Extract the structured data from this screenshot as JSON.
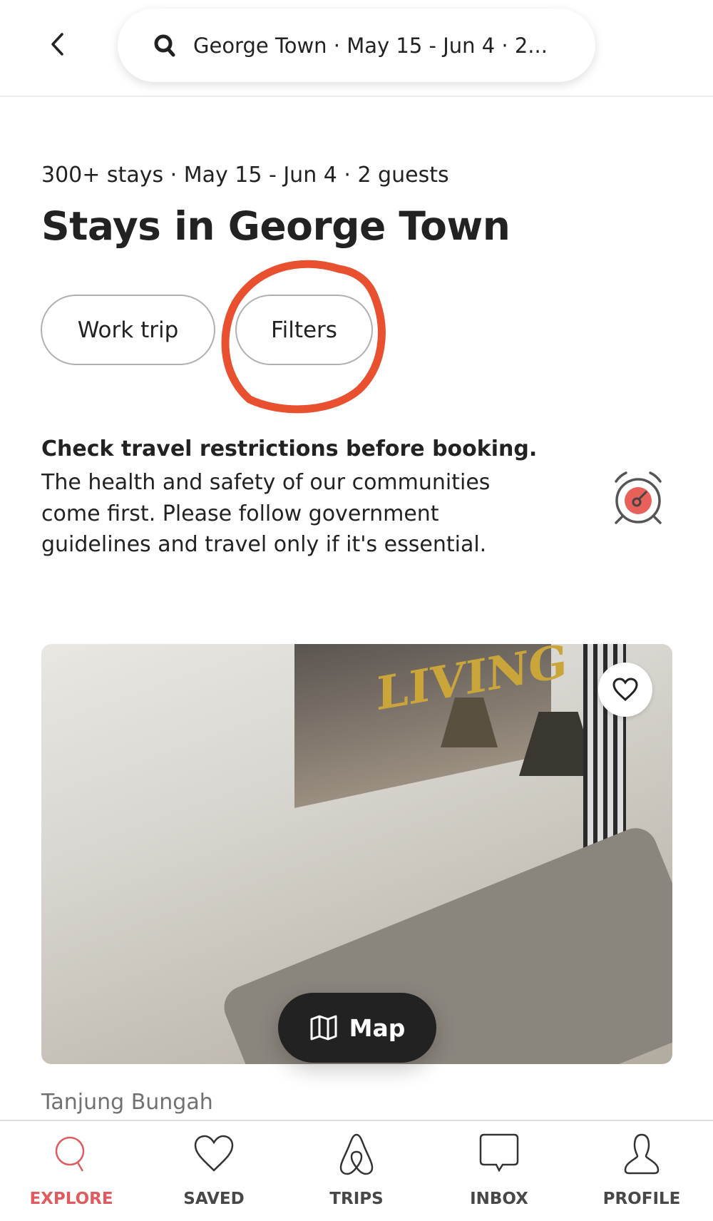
{
  "header": {
    "search_text": "George Town · May 15 - Jun 4 · 2..."
  },
  "summary": {
    "subtitle": "300+ stays · May 15 - Jun 4 · 2 guests",
    "title": "Stays in George Town"
  },
  "chips": [
    {
      "label": "Work trip"
    },
    {
      "label": "Filters",
      "annotated": true
    }
  ],
  "annotation_color": "#e8502f",
  "notice": {
    "heading": "Check travel restrictions before booking.",
    "body": "The health and safety of our communities come first. Please follow government guidelines and travel only if it's essential.",
    "icon": "alarm-clock-icon",
    "accent": "#e8605a"
  },
  "listing": {
    "location": "Tanjung Bungah",
    "image_text": "LIVING",
    "favorited": false
  },
  "map_button": {
    "label": "Map"
  },
  "nav": {
    "accent": "#e05b5f",
    "items": [
      {
        "label": "EXPLORE",
        "icon": "search-icon",
        "active": true
      },
      {
        "label": "SAVED",
        "icon": "heart-icon"
      },
      {
        "label": "TRIPS",
        "icon": "airbnb-logo-icon"
      },
      {
        "label": "INBOX",
        "icon": "chat-bubble-icon"
      },
      {
        "label": "PROFILE",
        "icon": "user-icon"
      }
    ]
  }
}
